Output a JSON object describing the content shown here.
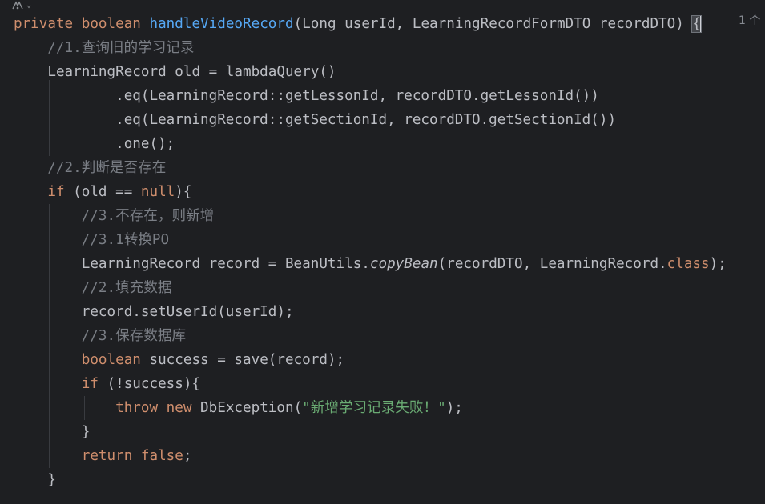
{
  "editor": {
    "usage_hint": "1 个",
    "lines": [
      {
        "tokens": [
          {
            "t": "kw",
            "v": "private "
          },
          {
            "t": "kw",
            "v": "boolean "
          },
          {
            "t": "fn",
            "v": "handleVideoRecord"
          },
          {
            "t": "tx",
            "v": "(Long userId, LearningRecordFormDTO recordDTO) "
          },
          {
            "t": "brace",
            "v": "{"
          }
        ]
      },
      {
        "tokens": [
          {
            "t": "cm",
            "v": "    //1.查询旧的学习记录"
          }
        ]
      },
      {
        "tokens": [
          {
            "t": "tx",
            "v": "    LearningRecord old = lambdaQuery()"
          }
        ]
      },
      {
        "tokens": [
          {
            "t": "tx",
            "v": "            .eq(LearningRecord::getLessonId, recordDTO.getLessonId())"
          }
        ]
      },
      {
        "tokens": [
          {
            "t": "tx",
            "v": "            .eq(LearningRecord::getSectionId, recordDTO.getSectionId())"
          }
        ]
      },
      {
        "tokens": [
          {
            "t": "tx",
            "v": "            .one();"
          }
        ]
      },
      {
        "tokens": [
          {
            "t": "cm",
            "v": "    //2.判断是否存在"
          }
        ]
      },
      {
        "tokens": [
          {
            "t": "tx",
            "v": "    "
          },
          {
            "t": "kw",
            "v": "if"
          },
          {
            "t": "tx",
            "v": " (old == "
          },
          {
            "t": "kw",
            "v": "null"
          },
          {
            "t": "tx",
            "v": "){"
          }
        ]
      },
      {
        "tokens": [
          {
            "t": "cm",
            "v": "        //3.不存在，则新增"
          }
        ]
      },
      {
        "tokens": [
          {
            "t": "cm",
            "v": "        //3.1转换PO"
          }
        ]
      },
      {
        "tokens": [
          {
            "t": "tx",
            "v": "        LearningRecord record = BeanUtils."
          },
          {
            "t": "it",
            "v": "copyBean"
          },
          {
            "t": "tx",
            "v": "(recordDTO, LearningRecord."
          },
          {
            "t": "kw",
            "v": "class"
          },
          {
            "t": "tx",
            "v": ");"
          }
        ]
      },
      {
        "tokens": [
          {
            "t": "cm",
            "v": "        //2.填充数据"
          }
        ]
      },
      {
        "tokens": [
          {
            "t": "tx",
            "v": "        record.setUserId(userId);"
          }
        ]
      },
      {
        "tokens": [
          {
            "t": "cm",
            "v": "        //3.保存数据库"
          }
        ]
      },
      {
        "tokens": [
          {
            "t": "tx",
            "v": "        "
          },
          {
            "t": "kw",
            "v": "boolean"
          },
          {
            "t": "tx",
            "v": " success = save(record);"
          }
        ]
      },
      {
        "tokens": [
          {
            "t": "tx",
            "v": "        "
          },
          {
            "t": "kw",
            "v": "if"
          },
          {
            "t": "tx",
            "v": " (!success){"
          }
        ]
      },
      {
        "tokens": [
          {
            "t": "tx",
            "v": "            "
          },
          {
            "t": "kw",
            "v": "throw new "
          },
          {
            "t": "tx",
            "v": "DbException("
          },
          {
            "t": "st",
            "v": "\"新增学习记录失败！\""
          },
          {
            "t": "tx",
            "v": ");"
          }
        ]
      },
      {
        "tokens": [
          {
            "t": "tx",
            "v": "        }"
          }
        ]
      },
      {
        "tokens": [
          {
            "t": "tx",
            "v": "        "
          },
          {
            "t": "kw",
            "v": "return false"
          },
          {
            "t": "tx",
            "v": ";"
          }
        ]
      },
      {
        "tokens": [
          {
            "t": "tx",
            "v": "    }"
          }
        ]
      }
    ]
  },
  "icons": {
    "assistant": "ai-assistant-icon",
    "dropdown": "chevron-down-icon"
  },
  "colors": {
    "background": "#1e1f22",
    "keyword": "#cf8e6d",
    "method_declaration": "#56a8f5",
    "comment": "#7a7e85",
    "string": "#6aab73",
    "default_text": "#bcbec4"
  }
}
